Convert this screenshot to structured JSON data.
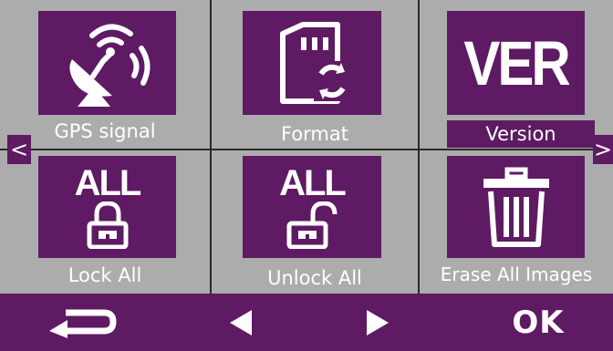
{
  "colors": {
    "accent": "#5e1a63",
    "panel": "#acacac",
    "divider": "#2a2a2a",
    "text": "#ffffff"
  },
  "menu": {
    "items": [
      {
        "label": "GPS signal",
        "icon": "satellite-dish-icon"
      },
      {
        "label": "Format",
        "icon": "sd-card-format-icon",
        "icon_text": ""
      },
      {
        "label": "Version",
        "icon": "version-icon",
        "icon_text": "VER"
      },
      {
        "label": "Lock All",
        "icon": "lock-all-icon",
        "icon_text": "ALL"
      },
      {
        "label": "Unlock All",
        "icon": "unlock-all-icon",
        "icon_text": "ALL"
      },
      {
        "label": "Erase All Images",
        "icon": "trash-icon"
      }
    ]
  },
  "nav": {
    "prev_page": "<",
    "next_page": ">"
  },
  "bottom_bar": {
    "back_icon": "return-arrow-icon",
    "left_icon": "triangle-left-icon",
    "right_icon": "triangle-right-icon",
    "ok_label": "OK"
  }
}
